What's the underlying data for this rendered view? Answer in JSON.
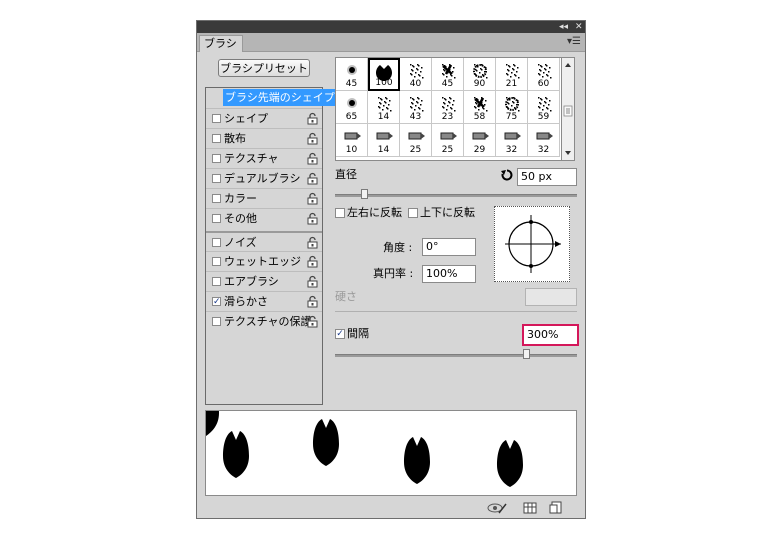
{
  "panel": {
    "tab": "ブラシ",
    "title_buttons": [
      "◂◂",
      "✕"
    ],
    "menu_icon": "panel-menu-icon"
  },
  "preset_button": "ブラシプリセット",
  "list": {
    "header": "ブラシ先端のシェイプ",
    "items": [
      {
        "label": "シェイプ",
        "checked": false
      },
      {
        "label": "散布",
        "checked": false
      },
      {
        "label": "テクスチャ",
        "checked": false
      },
      {
        "label": "デュアルブラシ",
        "checked": false
      },
      {
        "label": "カラー",
        "checked": false
      },
      {
        "label": "その他",
        "checked": false
      },
      {
        "label": "ノイズ",
        "checked": false
      },
      {
        "label": "ウェットエッジ",
        "checked": false
      },
      {
        "label": "エアブラシ",
        "checked": false
      },
      {
        "label": "滑らかさ",
        "checked": true
      },
      {
        "label": "テクスチャの保護",
        "checked": false
      }
    ]
  },
  "brush_sizes": [
    "45",
    "100",
    "40",
    "45",
    "90",
    "21",
    "60",
    "65",
    "14",
    "43",
    "23",
    "58",
    "75",
    "59",
    "10",
    "14",
    "25",
    "25",
    "29",
    "32",
    "32"
  ],
  "selected_brush": "100",
  "diameter": {
    "label": "直径",
    "value": "50 px",
    "slider": 0.12
  },
  "flip_x": {
    "label": "左右に反転",
    "checked": false
  },
  "flip_y": {
    "label": "上下に反転",
    "checked": false
  },
  "angle": {
    "label": "角度 :",
    "value": "0°"
  },
  "roundness": {
    "label": "真円率 :",
    "value": "100%"
  },
  "hardness": {
    "label": "硬さ",
    "value": ""
  },
  "spacing": {
    "label": "間隔",
    "checked": true,
    "value": "300%",
    "slider": 0.79
  },
  "bottom_icons": [
    "eye-brush-icon",
    "grid-icon",
    "new-page-icon"
  ]
}
